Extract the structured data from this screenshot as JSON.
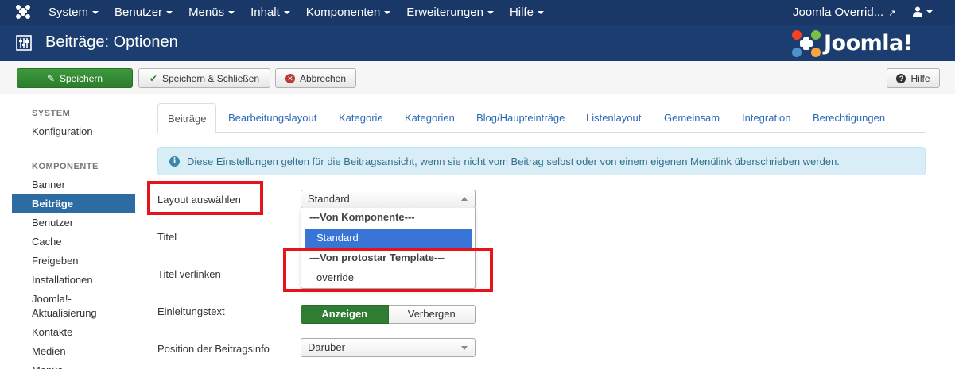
{
  "navbar": {
    "menu": [
      "System",
      "Benutzer",
      "Menüs",
      "Inhalt",
      "Komponenten",
      "Erweiterungen",
      "Hilfe"
    ],
    "site": "Joomla Overrid...",
    "user_icon": "user-icon"
  },
  "header": {
    "title": "Beiträge: Optionen",
    "brand": "Joomla!"
  },
  "toolbar": {
    "save": "Speichern",
    "save_close": "Speichern & Schließen",
    "cancel": "Abbrechen",
    "help": "Hilfe"
  },
  "sidebar": {
    "system_label": "SYSTEM",
    "config": "Konfiguration",
    "component_label": "KOMPONENTE",
    "items": [
      "Banner",
      "Beiträge",
      "Benutzer",
      "Cache",
      "Freigeben",
      "Installationen",
      "Joomla!-",
      "Aktualisierung",
      "Kontakte",
      "Medien",
      "Menüs"
    ]
  },
  "tabs": [
    "Beiträge",
    "Bearbeitungslayout",
    "Kategorie",
    "Kategorien",
    "Blog/Haupteinträge",
    "Listenlayout",
    "Gemeinsam",
    "Integration",
    "Berechtigungen"
  ],
  "alert": "Diese Einstellungen gelten für die Beitragsansicht, wenn sie nicht vom Beitrag selbst oder von einem eigenen Menülink überschrieben werden.",
  "form": {
    "layout_label": "Layout auswählen",
    "layout_value": "Standard",
    "title_label": "Titel",
    "title_link_label": "Titel verlinken",
    "intro_label": "Einleitungstext",
    "intro_show": "Anzeigen",
    "intro_hide": "Verbergen",
    "info_pos_label": "Position der Beitragsinfo",
    "info_pos_value": "Darüber"
  },
  "dropdown": {
    "group1": "---Von Komponente---",
    "opt1": "Standard",
    "group2": "---Von protostar Template---",
    "opt2": "override"
  },
  "colors": {
    "navbar": "#1a3867",
    "header": "#1c3d6f",
    "save_button": "#2d7d2d",
    "active_sidebar": "#2d6ca2",
    "highlight": "#e8121b"
  }
}
